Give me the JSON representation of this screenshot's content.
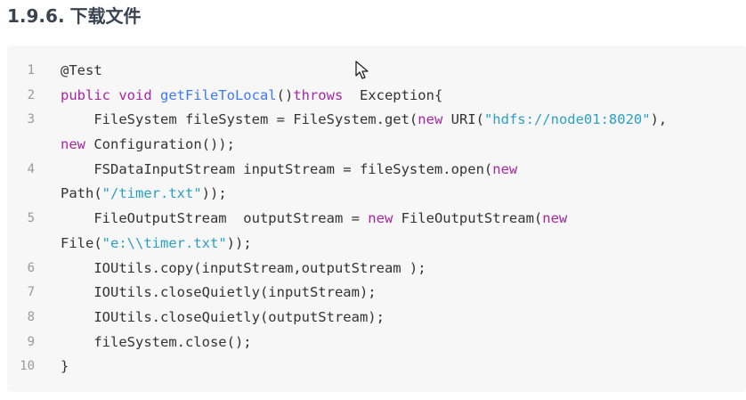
{
  "heading": {
    "number": "1.9.6.",
    "title": "下载文件"
  },
  "code": {
    "lines": [
      {
        "number": "1",
        "visual_lines": [
          [
            {
              "t": "@Test",
              "c": "plain"
            }
          ]
        ]
      },
      {
        "number": "2",
        "visual_lines": [
          [
            {
              "t": "public void ",
              "c": "kw"
            },
            {
              "t": "getFileToLocal",
              "c": "fn"
            },
            {
              "t": "()",
              "c": "plain"
            },
            {
              "t": "throws",
              "c": "kw"
            },
            {
              "t": "  Exception{",
              "c": "plain"
            }
          ]
        ]
      },
      {
        "number": "3",
        "visual_lines": [
          [
            {
              "t": "    FileSystem fileSystem = FileSystem.get(",
              "c": "plain"
            },
            {
              "t": "new",
              "c": "kw"
            },
            {
              "t": " URI(",
              "c": "plain"
            },
            {
              "t": "\"hdfs://node01:8020\"",
              "c": "str"
            },
            {
              "t": "),",
              "c": "plain"
            }
          ],
          [
            {
              "t": "new",
              "c": "kw"
            },
            {
              "t": " Configuration());",
              "c": "plain"
            }
          ]
        ]
      },
      {
        "number": "4",
        "visual_lines": [
          [
            {
              "t": "    FSDataInputStream inputStream = fileSystem.open(",
              "c": "plain"
            },
            {
              "t": "new",
              "c": "kw"
            }
          ],
          [
            {
              "t": "Path(",
              "c": "plain"
            },
            {
              "t": "\"/timer.txt\"",
              "c": "str"
            },
            {
              "t": "));",
              "c": "plain"
            }
          ]
        ]
      },
      {
        "number": "5",
        "visual_lines": [
          [
            {
              "t": "    FileOutputStream  outputStream = ",
              "c": "plain"
            },
            {
              "t": "new",
              "c": "kw"
            },
            {
              "t": " FileOutputStream(",
              "c": "plain"
            },
            {
              "t": "new",
              "c": "kw"
            }
          ],
          [
            {
              "t": "File(",
              "c": "plain"
            },
            {
              "t": "\"e:\\\\timer.txt\"",
              "c": "str"
            },
            {
              "t": "));",
              "c": "plain"
            }
          ]
        ]
      },
      {
        "number": "6",
        "visual_lines": [
          [
            {
              "t": "    IOUtils.copy(inputStream,outputStream );",
              "c": "plain"
            }
          ]
        ]
      },
      {
        "number": "7",
        "visual_lines": [
          [
            {
              "t": "    IOUtils.closeQuietly(inputStream);",
              "c": "plain"
            }
          ]
        ]
      },
      {
        "number": "8",
        "visual_lines": [
          [
            {
              "t": "    IOUtils.closeQuietly(outputStream);",
              "c": "plain"
            }
          ]
        ]
      },
      {
        "number": "9",
        "visual_lines": [
          [
            {
              "t": "    fileSystem.close();",
              "c": "plain"
            }
          ]
        ]
      },
      {
        "number": "10",
        "visual_lines": [
          [
            {
              "t": "}",
              "c": "plain"
            }
          ]
        ]
      }
    ]
  },
  "icons": {
    "cursor": "mouse-pointer-icon"
  }
}
